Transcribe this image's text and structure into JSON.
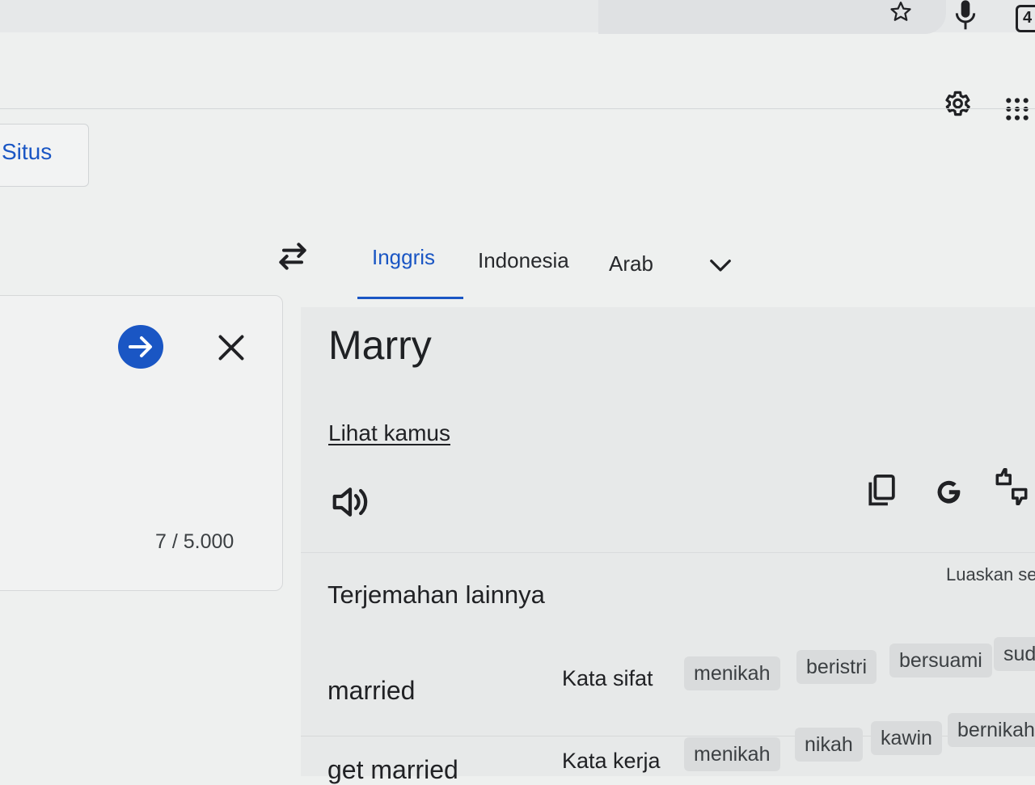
{
  "header": {
    "sites_label": "Situs"
  },
  "language_tabs": [
    {
      "label": "Inggris",
      "active": true
    },
    {
      "label": "Indonesia",
      "active": false
    },
    {
      "label": "Arab",
      "active": false
    }
  ],
  "source": {
    "char_count": "7 / 5.000"
  },
  "target": {
    "translation": "Marry",
    "dictionary_link": "Lihat kamus"
  },
  "more_translations": {
    "title": "Terjemahan lainnya",
    "expand_label": "Luaskan se",
    "rows": [
      {
        "word": "married",
        "pos": "Kata sifat",
        "chips": [
          "menikah",
          "beristri",
          "bersuami",
          "sud"
        ]
      },
      {
        "word": "get married",
        "pos": "Kata kerja",
        "chips": [
          "menikah",
          "nikah",
          "kawin",
          "bernikah"
        ]
      }
    ]
  },
  "colors": {
    "accent": "#1a56c4",
    "text": "#202124",
    "chip_bg": "#d9dbdc"
  },
  "icons": [
    "star-icon",
    "mic-icon",
    "tab-count-icon",
    "settings-icon",
    "apps-icon",
    "swap-languages-icon",
    "chevron-down-icon",
    "translate-arrow-icon",
    "close-icon",
    "speaker-icon",
    "copy-icon",
    "google-g-icon",
    "feedback-icon"
  ]
}
